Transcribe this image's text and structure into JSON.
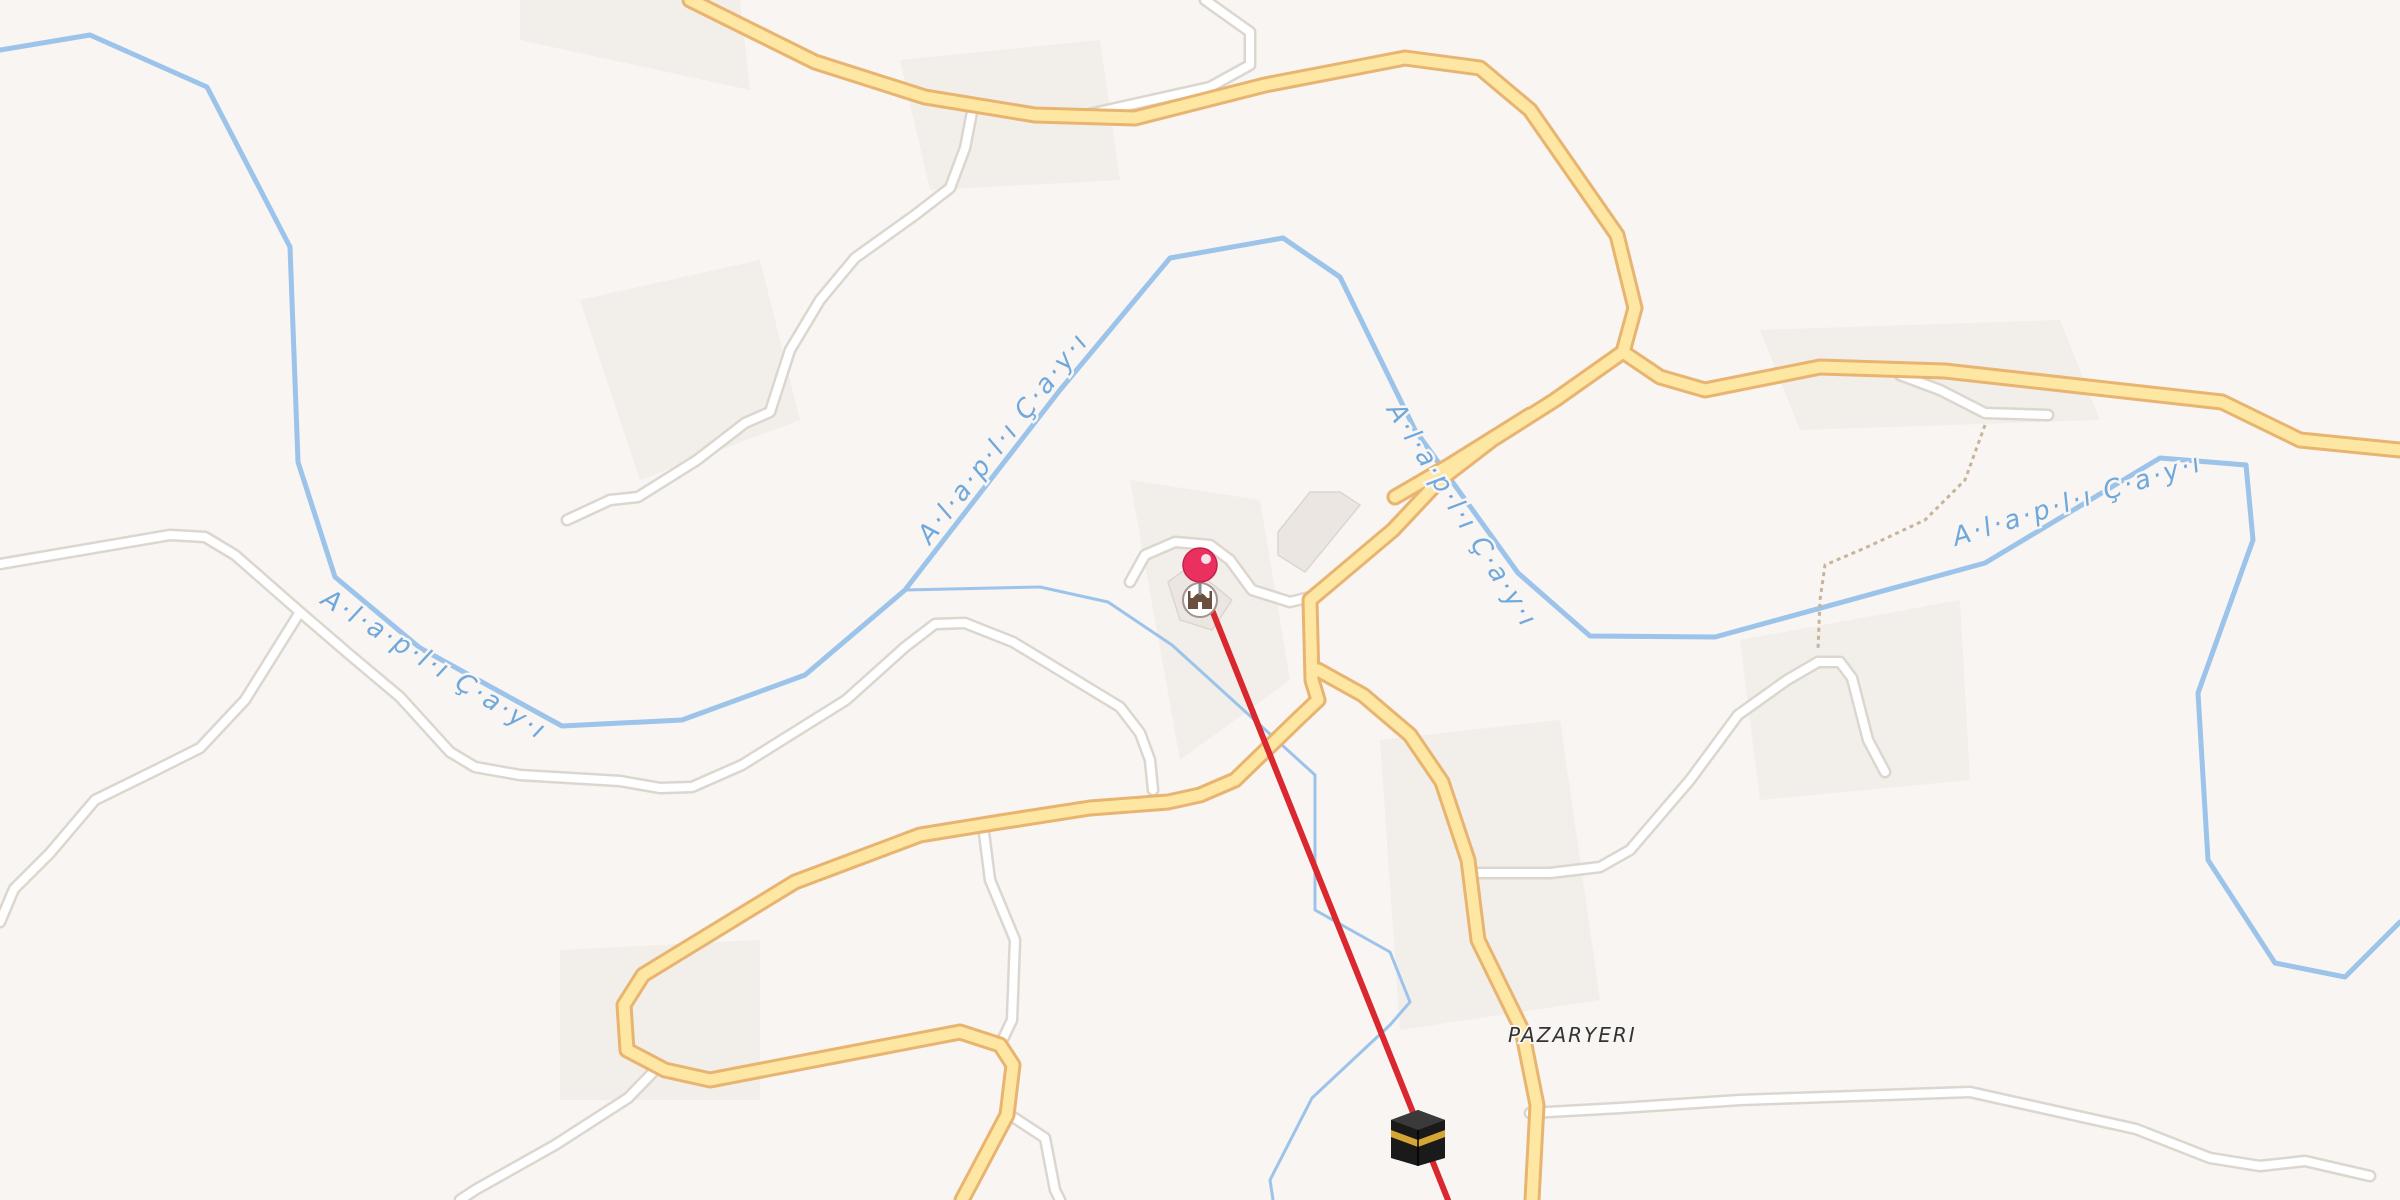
{
  "map": {
    "colors": {
      "land": "#f8f5f2",
      "water": "#9cc3ea",
      "main_road_fill": "#fde7a3",
      "main_road_casing": "#e8b470",
      "minor_road_fill": "#ffffff",
      "minor_road_casing": "#dcd6cf",
      "route_line": "#d9282e",
      "pin": "#e9305f",
      "building": "#ebe6e1"
    },
    "labels": {
      "river_1": "A·l·a·p·l·ı Ç·a·y·ı",
      "river_2": "A·l·a·p·l·ı Ç·a·y·ı",
      "river_3": "A·l·a·p·l·ı Ç·a·y·ı",
      "river_4": "A·l·a·p·l·ı Ç·a·y·ı",
      "place": "PAZARYERI"
    },
    "markers": {
      "location_pin": "pin-icon",
      "mosque": "mosque-icon",
      "kaaba": "kaaba-icon"
    }
  }
}
